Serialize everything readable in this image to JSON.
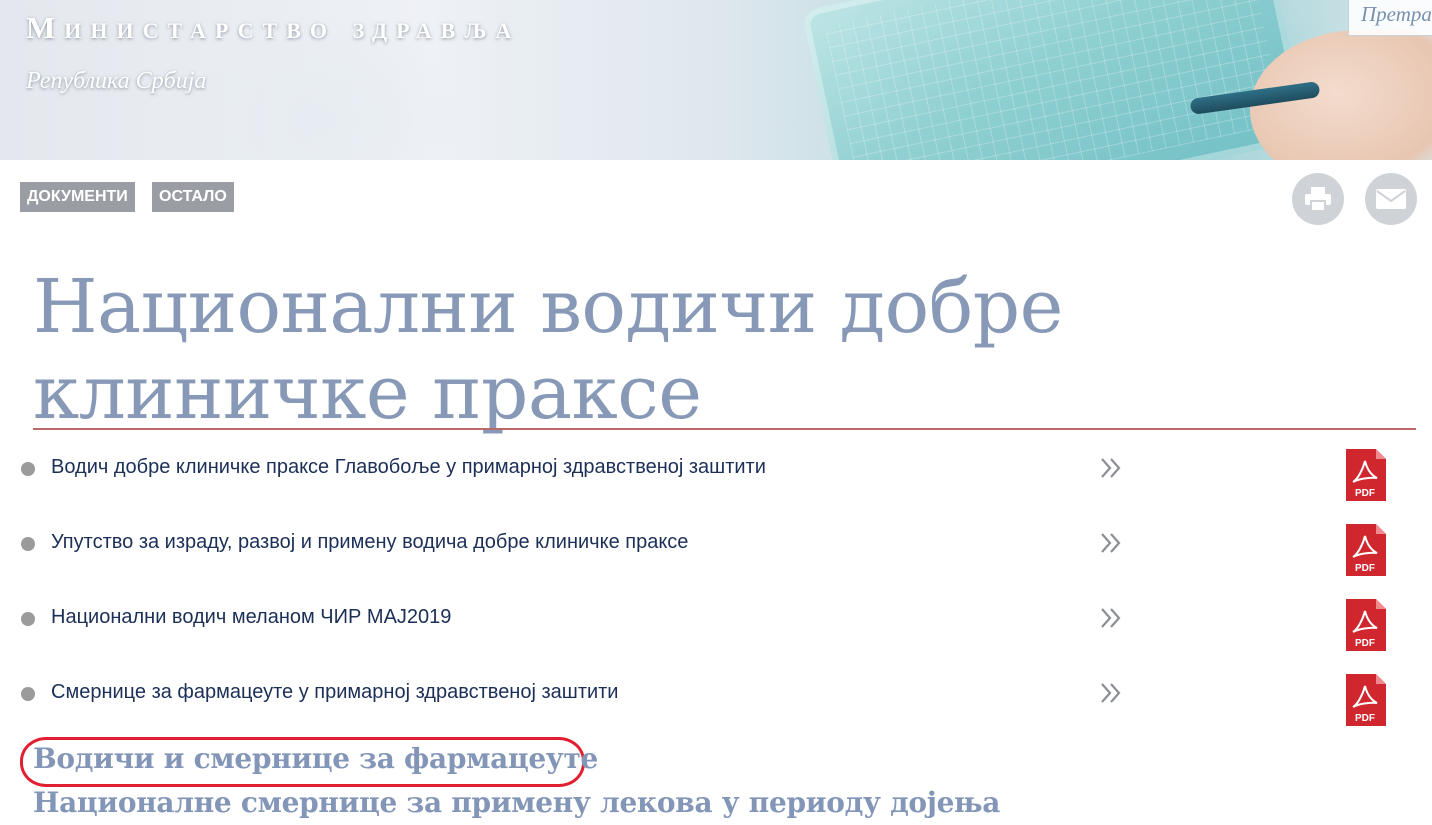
{
  "header": {
    "ministry_title": "Министарство здравља",
    "ministry_subtitle": "Република Србија",
    "search_placeholder": "Претрага"
  },
  "breadcrumb": {
    "items": [
      {
        "label": "Документи"
      },
      {
        "label": "Остало"
      }
    ]
  },
  "tools": {
    "print_icon": "printer-icon",
    "mail_icon": "envelope-icon"
  },
  "page": {
    "title": "Национални водичи добре клиничке праксе"
  },
  "documents": [
    {
      "label": "Водич добре клиничке праксе Главобоље у примарној здравственој заштити",
      "file_type": "PDF"
    },
    {
      "label": "Упутство за израду, развој и примену водича добре клиничке праксе",
      "file_type": "PDF"
    },
    {
      "label": "Национални водич меланом ЧИР МАЈ2019",
      "file_type": "PDF"
    },
    {
      "label": "Смернице за фармацеуте у примарној здравственој заштити",
      "file_type": "PDF"
    }
  ],
  "links": [
    {
      "label": "Водичи и смернице за фармацеуте",
      "highlighted": true,
      "highlight_color": "#e02030"
    },
    {
      "label": "Националне смернице за примену лекова у периоду дојења",
      "highlighted": false
    }
  ],
  "colors": {
    "title": "#8799b7",
    "rule": "#b96a6a",
    "crumb_bg": "#9a9ea4",
    "pdf_red": "#d0272e"
  }
}
